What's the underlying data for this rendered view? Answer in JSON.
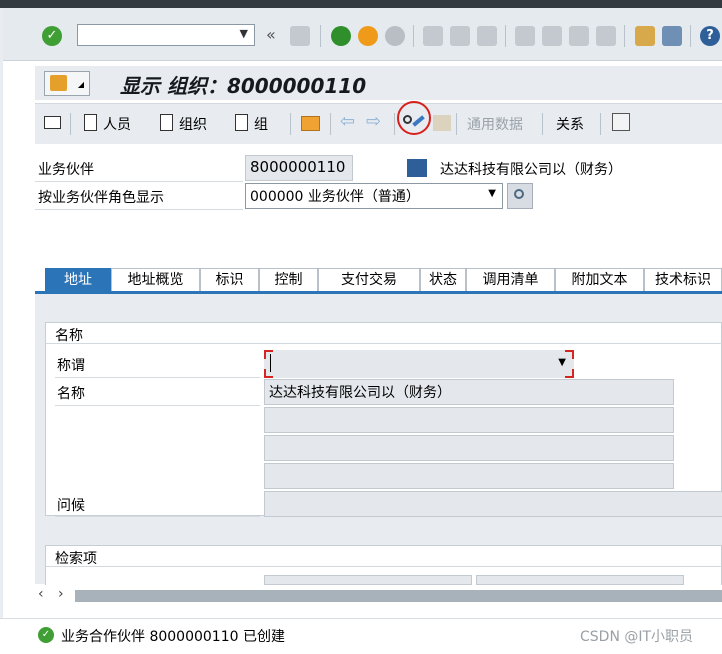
{
  "window": {
    "title": "显示 组织：8000000110"
  },
  "toolbar": {
    "command_field_value": "",
    "icons": [
      "enter-icon",
      "back-icon",
      "exit-icon",
      "cancel-icon",
      "print-icon",
      "find-icon",
      "find-next-icon",
      "first-page-icon",
      "previous-page-icon",
      "next-page-icon",
      "last-page-icon",
      "new-session-icon",
      "shortcut-icon",
      "help-icon"
    ],
    "colors": {
      "ok": "#3f9e34",
      "back": "#2f8f2a",
      "exit": "#f09a1a"
    }
  },
  "app_toolbar": {
    "person": "人员",
    "organization": "组织",
    "group": "组",
    "general_data": "通用数据",
    "relations": "关系",
    "highlight_color": "#d9201c"
  },
  "header": {
    "bp_label": "业务伙伴",
    "bp_value": "8000000110",
    "bp_name": "达达科技有限公司以（财务）",
    "role_label": "按业务伙伴角色显示",
    "role_value": "000000 业务伙伴（普通）"
  },
  "tabs": [
    {
      "label": "地址",
      "active": true
    },
    {
      "label": "地址概览",
      "active": false
    },
    {
      "label": "标识",
      "active": false
    },
    {
      "label": "控制",
      "active": false
    },
    {
      "label": "支付交易",
      "active": false
    },
    {
      "label": "状态",
      "active": false
    },
    {
      "label": "调用清单",
      "active": false
    },
    {
      "label": "附加文本",
      "active": false
    },
    {
      "label": "技术标识",
      "active": false
    }
  ],
  "name_group": {
    "title": "名称",
    "salutation_label": "称谓",
    "salutation_value": "",
    "name_label": "名称",
    "name_value": "达达科技有限公司以（财务）",
    "greeting_label": "问候"
  },
  "search_group": {
    "title": "检索项"
  },
  "status": {
    "message": "业务合作伙伴 8000000110 已创建",
    "watermark": "CSDN @IT小职员"
  }
}
